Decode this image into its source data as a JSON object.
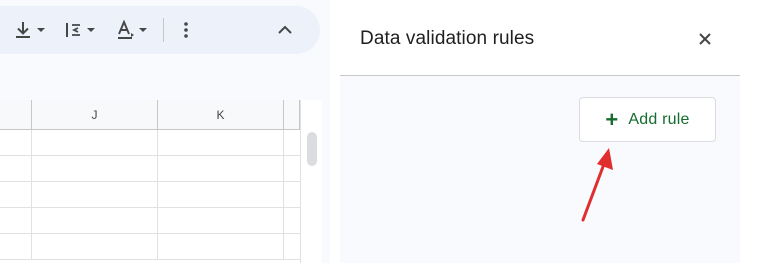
{
  "toolbar": {
    "buttons": [
      {
        "name": "vertical-align-button",
        "icon": "vertical-align-bottom-icon"
      },
      {
        "name": "text-direction-button",
        "icon": "text-direction-rtl-icon"
      },
      {
        "name": "text-color-button",
        "icon": "text-color-a-icon"
      },
      {
        "name": "more-options-button",
        "icon": "more-vert-icon"
      },
      {
        "name": "collapse-toolbar-button",
        "icon": "chevron-up-icon"
      }
    ]
  },
  "sheet": {
    "columns": [
      "J",
      "K"
    ],
    "visible_rows": 5
  },
  "panel": {
    "title": "Data validation rules",
    "close_icon": "close-icon",
    "add_rule_label": "Add rule",
    "add_rule_icon": "plus-icon"
  },
  "annotation": {
    "type": "arrow",
    "color": "#e02d2d",
    "points_to": "add-rule-button"
  },
  "colors": {
    "accent_green": "#146c2e",
    "toolbar_bg": "#edf2fa",
    "panel_bg": "#f8fafd"
  }
}
